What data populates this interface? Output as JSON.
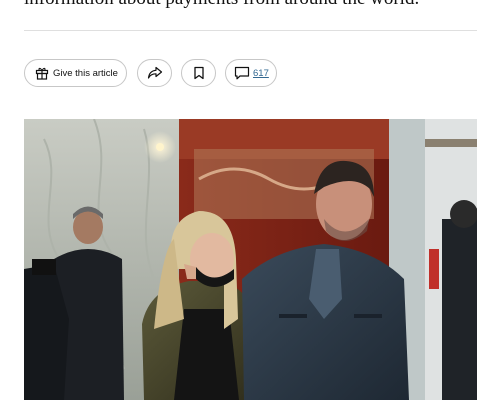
{
  "article": {
    "partial_text": "information about payments from around the world."
  },
  "toolbar": {
    "gift_label": "Give this article",
    "comment_count": "617",
    "icons": {
      "gift": "gift-icon",
      "share": "share-arrow-icon",
      "save": "bookmark-icon",
      "comment": "comment-bubble-icon"
    }
  },
  "colors": {
    "link": "#326891",
    "text": "#121212",
    "border": "#c7c7c7"
  }
}
